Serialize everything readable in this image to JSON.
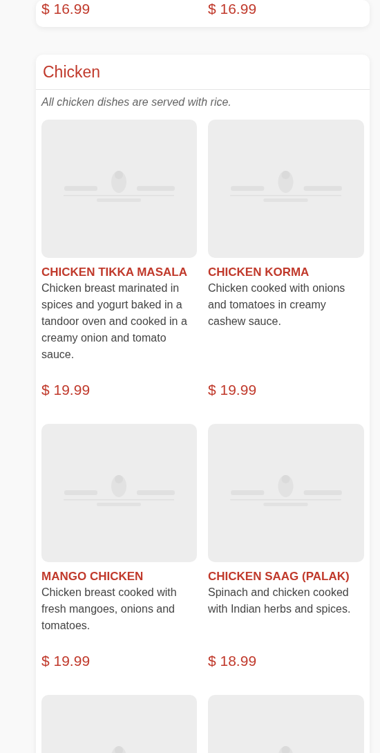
{
  "previous_section": {
    "prices": [
      "$ 16.99",
      "$ 16.99"
    ]
  },
  "section": {
    "title": "Chicken",
    "note": "All chicken dishes are served with rice.",
    "items": [
      {
        "kind": "dish",
        "name": "CHICKEN TIKKA MASALA",
        "description": "Chicken breast marinated in spices and yogurt baked in a tandoor oven and cooked in a creamy onion and tomato sauce.",
        "price": "$ 19.99"
      },
      {
        "kind": "dish",
        "name": "CHICKEN KORMA",
        "description": "Chicken cooked with onions and tomatoes in creamy cashew sauce.",
        "price": "$ 19.99"
      },
      {
        "kind": "dish",
        "name": "MANGO CHICKEN",
        "description": "Chicken breast cooked with fresh mangoes, onions and tomatoes.",
        "price": "$ 19.99"
      },
      {
        "kind": "dish",
        "name": "CHICKEN SAAG (PALAK)",
        "description": "Spinach and chicken cooked with Indian herbs and spices.",
        "price": "$ 18.99"
      },
      {
        "kind": "picture"
      },
      {
        "kind": "picture"
      }
    ]
  }
}
